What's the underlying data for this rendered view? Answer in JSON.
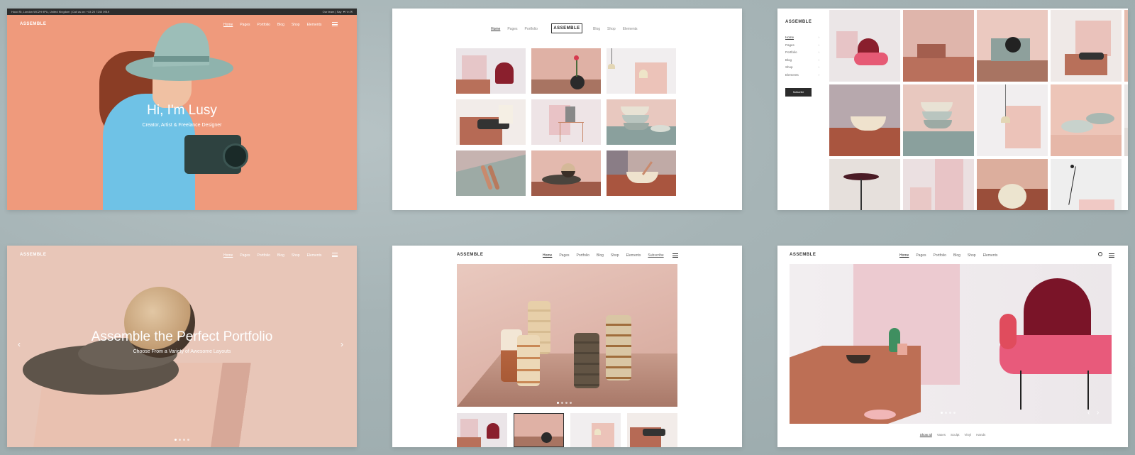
{
  "card1": {
    "topbar_left": "Hood St, London WC2H 9PU, United Kingdom | Call us on: +44 20 7240 0919",
    "topbar_right": "Our team | Say",
    "logo": "ASSEMBLE",
    "nav": [
      "Home",
      "Pages",
      "Portfolio",
      "Blog",
      "Shop",
      "Elements"
    ],
    "hero_title": "Hi, I'm Lusy",
    "hero_subtitle": "Creator, Artist & Freelance Designer",
    "accent": "#ef9a7c"
  },
  "card2": {
    "nav_left": [
      "Home",
      "Pages",
      "Portfolio"
    ],
    "logo": "ASSEMBLE",
    "nav_right": [
      "Blog",
      "Shop",
      "Elements"
    ],
    "tiles": [
      {
        "icon": "pink-chair-image"
      },
      {
        "icon": "vase-rose-image"
      },
      {
        "icon": "pendant-lamp-image"
      },
      {
        "icon": "box-textile-image"
      },
      {
        "icon": "wire-chair-image"
      },
      {
        "icon": "stacked-bowls-image"
      },
      {
        "icon": "copper-spoons-image"
      },
      {
        "icon": "sphere-disc-image"
      },
      {
        "icon": "bowl-spoon-image"
      }
    ]
  },
  "card3": {
    "logo": "ASSEMBLE",
    "menu": [
      "Home",
      "Pages",
      "Portfolio",
      "Blog",
      "Shop",
      "Elements"
    ],
    "button": "Subscribe"
  },
  "card4": {
    "logo": "ASSEMBLE",
    "nav": [
      "Home",
      "Pages",
      "Portfolio",
      "Blog",
      "Shop",
      "Elements"
    ],
    "hero_title": "Assemble the Perfect Portfolio",
    "hero_subtitle": "Choose From a Variety of Awesome Layouts"
  },
  "card5": {
    "logo": "ASSEMBLE",
    "nav": [
      "Home",
      "Pages",
      "Portfolio",
      "Blog",
      "Shop",
      "Elements",
      "Subscribe"
    ]
  },
  "card6": {
    "logo": "ASSEMBLE",
    "nav": [
      "Home",
      "Pages",
      "Portfolio",
      "Blog",
      "Shop",
      "Elements"
    ],
    "filters": [
      "Show all",
      "Vases",
      "Sculpt",
      "Vinyl",
      "Hands"
    ]
  }
}
